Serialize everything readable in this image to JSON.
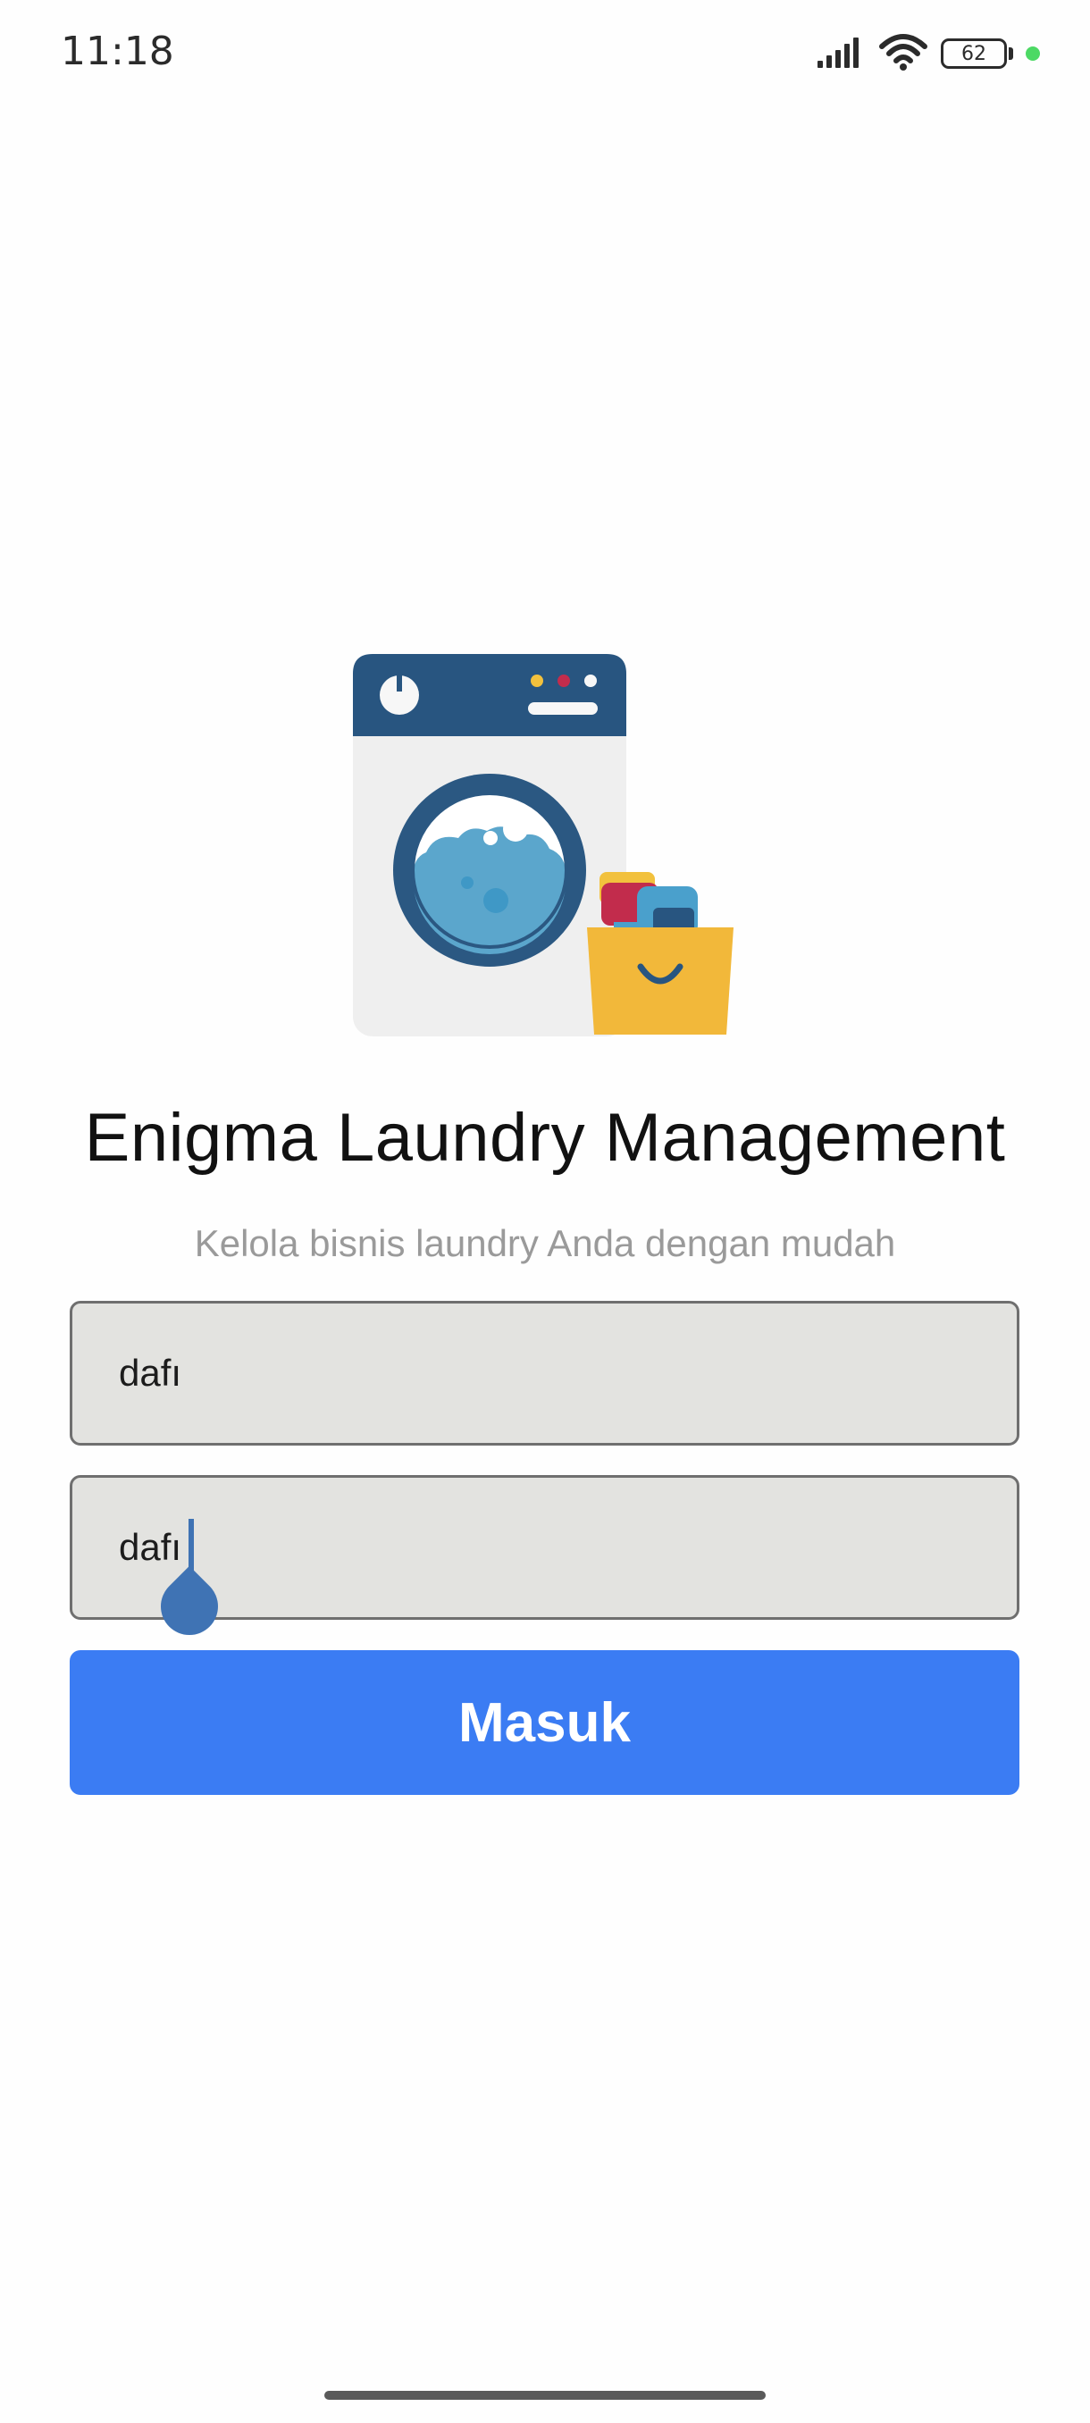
{
  "status_bar": {
    "time": "11:18",
    "battery_level": "62",
    "icons": [
      "signal-icon",
      "wifi-icon",
      "battery-icon",
      "privacy-indicator-dot"
    ]
  },
  "header": {
    "illustration": "washing-machine-laundry-basket-illustration",
    "title": "Enigma Laundry Management",
    "subtitle": "Kelola bisnis laundry Anda dengan mudah"
  },
  "form": {
    "username_value": "dafı",
    "password_value": "dafı",
    "submit_label": "Masuk"
  },
  "colors": {
    "primary_button": "#3b7cf3",
    "field_background": "#e3e3e0",
    "cursor": "#3f73b4",
    "subtitle_text": "#9a9a9a"
  }
}
